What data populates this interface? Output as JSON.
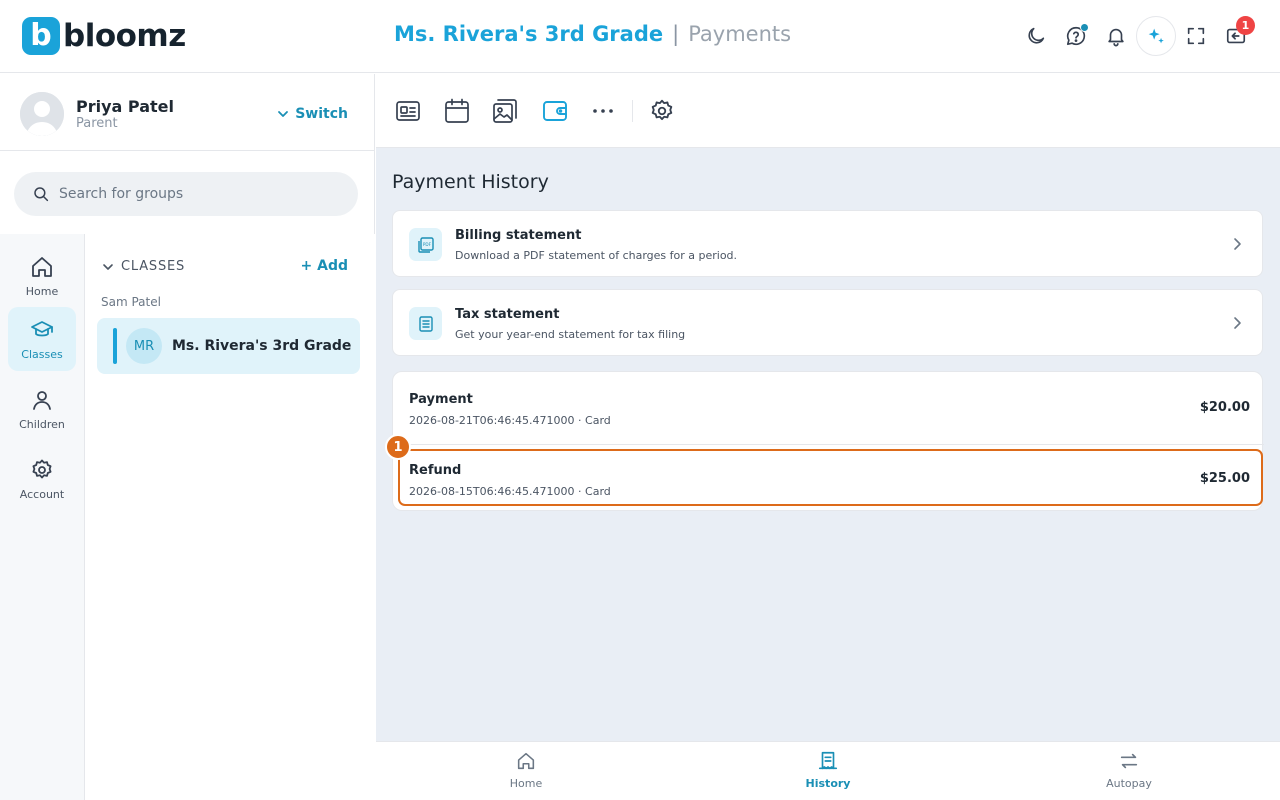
{
  "brand": {
    "logo_letter": "b",
    "name": "bloomz",
    "color": "#1aa3d9"
  },
  "header": {
    "group_title": "Ms. Rivera's 3rd Grade",
    "separator": "|",
    "section_title": "Payments",
    "icons": [
      "moon-icon",
      "help-icon",
      "bell-icon",
      "sparkle-icon",
      "fullscreen-icon",
      "inbox-icon"
    ],
    "inbox_badge": "1"
  },
  "profile": {
    "name": "Priya Patel",
    "role": "Parent",
    "switch_label": "Switch"
  },
  "search": {
    "placeholder": "Search for groups",
    "value": ""
  },
  "rail": {
    "items": [
      {
        "label": "Home",
        "icon": "home-icon",
        "active": false
      },
      {
        "label": "Classes",
        "icon": "graduation-cap-icon",
        "active": true
      },
      {
        "label": "Children",
        "icon": "person-icon",
        "active": false
      },
      {
        "label": "Account",
        "icon": "gear-icon",
        "active": false
      }
    ]
  },
  "groups": {
    "heading": "CLASSES",
    "add_label": "+ Add",
    "child_name": "Sam Patel",
    "class": {
      "initials": "MR",
      "name": "Ms. Rivera's 3rd Grade"
    }
  },
  "toolbar": {
    "tools": [
      "newsfeed-icon",
      "calendar-icon",
      "photos-icon",
      "wallet-icon",
      "more-icon",
      "settings-icon"
    ],
    "active_tool": "wallet-icon"
  },
  "payments": {
    "title": "Payment History",
    "statements": [
      {
        "title": "Billing statement",
        "description": "Download a PDF statement of charges for a period.",
        "icon": "pdf-icon"
      },
      {
        "title": "Tax statement",
        "description": "Get your year-end statement for tax filing",
        "icon": "document-lines-icon"
      }
    ],
    "transactions": [
      {
        "type": "Payment",
        "meta": "2026-08-21T06:46:45.471000 · Card",
        "amount": "$20.00"
      },
      {
        "type": "Refund",
        "meta": "2026-08-15T06:46:45.471000 · Card",
        "amount": "$25.00"
      }
    ],
    "highlight_marker": "1",
    "highlight_color": "#dd6b1a"
  },
  "bottom_nav": {
    "items": [
      {
        "label": "Home",
        "icon": "home-icon",
        "active": false
      },
      {
        "label": "History",
        "icon": "receipt-icon",
        "active": true
      },
      {
        "label": "Autopay",
        "icon": "swap-arrows-icon",
        "active": false
      }
    ]
  }
}
